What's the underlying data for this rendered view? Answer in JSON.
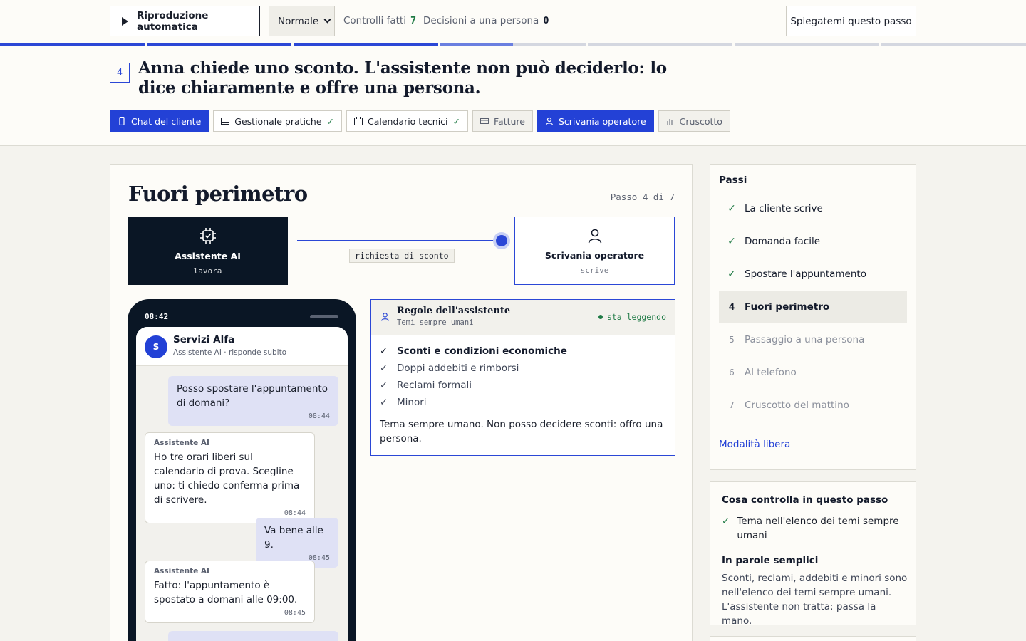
{
  "toolbar": {
    "autoplay_label": "Riproduzione automatica",
    "speed_value": "Normale",
    "checks_label": "Controlli fatti",
    "checks_count": "7",
    "handoffs_label": "Decisioni a una persona",
    "handoffs_count": "0",
    "explain_label": "Spiegatemi questo passo"
  },
  "progress": {
    "total_steps": 7,
    "done_steps": 3,
    "current_step": 4
  },
  "step": {
    "number": "4",
    "headline": "Anna chiede uno sconto. L'assistente non può deciderlo: lo dice chiaramente e offre una persona."
  },
  "apps": [
    {
      "label": "Chat del cliente",
      "icon": "phone-icon",
      "state": "active",
      "checked": false
    },
    {
      "label": "Gestionale pratiche",
      "icon": "table-icon",
      "state": "normal",
      "checked": true
    },
    {
      "label": "Calendario tecnici",
      "icon": "calendar-icon",
      "state": "normal",
      "checked": true
    },
    {
      "label": "Fatture",
      "icon": "card-icon",
      "state": "dim",
      "checked": false
    },
    {
      "label": "Scrivania operatore",
      "icon": "person-icon",
      "state": "active",
      "checked": false
    },
    {
      "label": "Cruscotto",
      "icon": "bar-chart-icon",
      "state": "dim",
      "checked": false
    }
  ],
  "main": {
    "title": "Fuori perimetro",
    "step_of": "Passo 4 di 7",
    "flow": {
      "ai": {
        "name": "Assistente AI",
        "state": "lavora",
        "icon": "chip-check-icon"
      },
      "link_label": "richiesta di sconto",
      "operator": {
        "name": "Scrivania operatore",
        "state": "scrive",
        "icon": "person-icon"
      }
    }
  },
  "phone": {
    "time": "08:42",
    "contact": "Servizi Alfa",
    "avatar_letter": "S",
    "contact_sub": "Assistente AI · risponde subito",
    "messages": [
      {
        "from": "user",
        "text": "Posso spostare l'appuntamento di domani?",
        "time": "08:44"
      },
      {
        "from": "bot",
        "who": "Assistente AI",
        "text": "Ho tre orari liberi sul calendario di prova. Scegline uno: ti chiedo conferma prima di scrivere.",
        "time": "08:44"
      },
      {
        "from": "user",
        "text": "Va bene alle 9.",
        "time": "08:45"
      },
      {
        "from": "bot",
        "who": "Assistente AI",
        "text": "Fatto: l'appuntamento è spostato a domani alle 09:00.",
        "time": "08:45"
      }
    ]
  },
  "rules": {
    "title": "Regole dell'assistente",
    "subtitle": "Temi sempre umani",
    "status": "sta leggendo",
    "items": [
      {
        "label": "Sconti e condizioni economiche",
        "highlighted": true
      },
      {
        "label": "Doppi addebiti e rimborsi",
        "highlighted": false
      },
      {
        "label": "Reclami formali",
        "highlighted": false
      },
      {
        "label": "Minori",
        "highlighted": false
      }
    ],
    "note": "Tema sempre umano. Non posso decidere sconti: offro una persona."
  },
  "sidebar": {
    "title": "Passi",
    "steps": [
      {
        "num": "1",
        "label": "La cliente scrive",
        "state": "done"
      },
      {
        "num": "2",
        "label": "Domanda facile",
        "state": "done"
      },
      {
        "num": "3",
        "label": "Spostare l'appuntamento",
        "state": "done"
      },
      {
        "num": "4",
        "label": "Fuori perimetro",
        "state": "current"
      },
      {
        "num": "5",
        "label": "Passaggio a una persona",
        "state": "todo"
      },
      {
        "num": "6",
        "label": "Al telefono",
        "state": "todo"
      },
      {
        "num": "7",
        "label": "Cruscotto del mattino",
        "state": "todo"
      }
    ],
    "free_mode": "Modalità libera"
  },
  "check_panel": {
    "title": "Cosa controlla in questo passo",
    "item": "Tema nell'elenco dei temi sempre umani",
    "plain_title": "In parole semplici",
    "plain_text": "Sconti, reclami, addebiti e minori sono nell'elenco dei temi sempre umani. L'assistente non tratta: passa la mano."
  },
  "colors": {
    "accent": "#2341d6",
    "ok": "#1f7a45",
    "dark": "#0a1625"
  }
}
